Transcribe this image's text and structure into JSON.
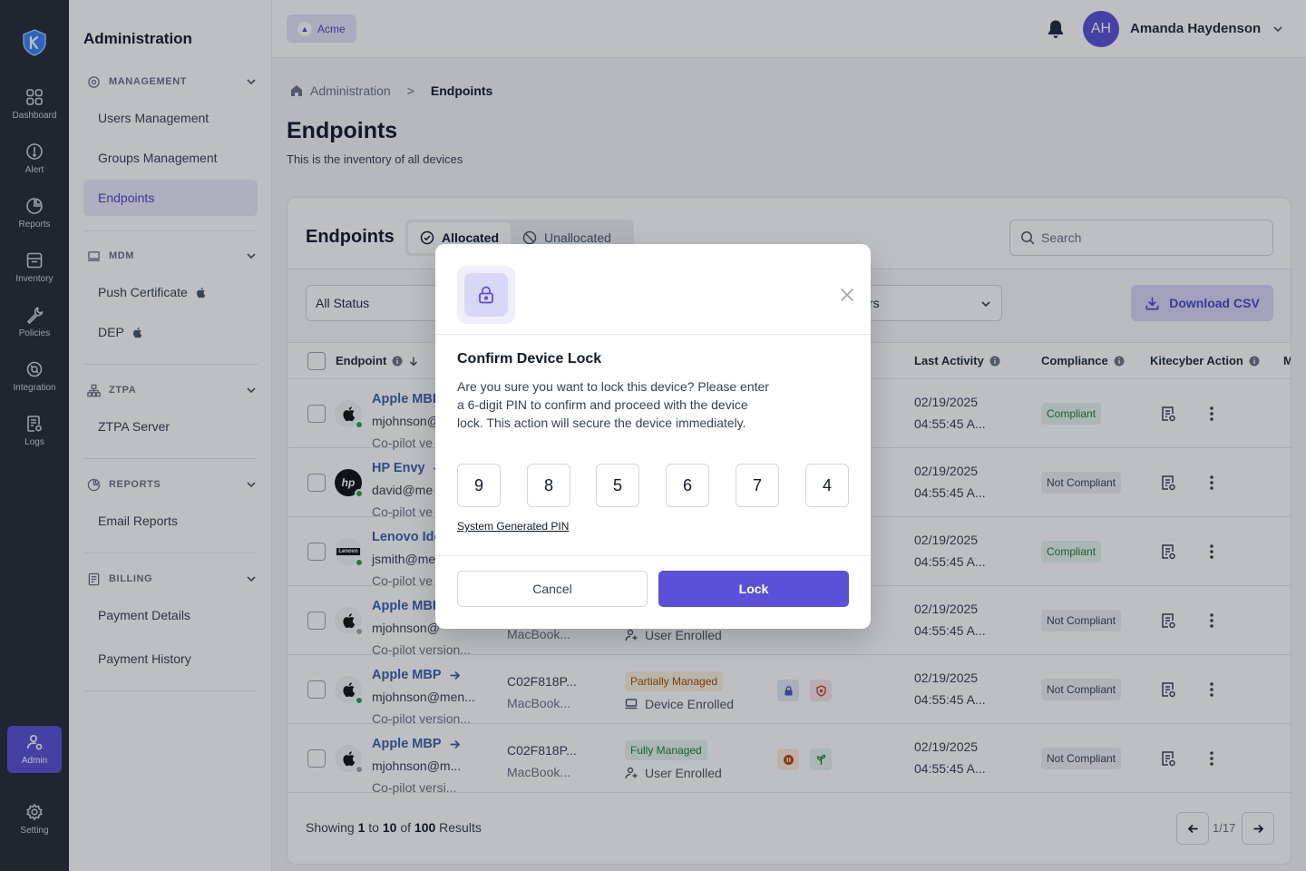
{
  "rail": {
    "items": [
      {
        "label": "Dashboard"
      },
      {
        "label": "Alert"
      },
      {
        "label": "Reports"
      },
      {
        "label": "Inventory"
      },
      {
        "label": "Policies"
      },
      {
        "label": "Integration"
      },
      {
        "label": "Logs"
      },
      {
        "label": "Admin"
      },
      {
        "label": "Setting"
      }
    ]
  },
  "sidebar": {
    "title": "Administration",
    "sections": [
      {
        "label": "MANAGEMENT",
        "items": [
          "Users Management",
          "Groups Management",
          "Endpoints"
        ]
      },
      {
        "label": "MDM",
        "items": [
          "Push Certificate",
          "DEP"
        ]
      },
      {
        "label": "ZTPA",
        "items": [
          "ZTPA Server"
        ]
      },
      {
        "label": "REPORTS",
        "items": [
          "Email Reports"
        ]
      },
      {
        "label": "BILLING",
        "items": [
          "Payment Details",
          "Payment History"
        ]
      }
    ]
  },
  "header": {
    "tenant": "Acme",
    "avatar_initials": "AH",
    "user_name": "Amanda Haydenson"
  },
  "breadcrumb": {
    "parent": "Administration",
    "current": "Endpoints"
  },
  "page": {
    "title": "Endpoints",
    "subtitle": "This is the inventory of all devices"
  },
  "card": {
    "title": "Endpoints",
    "tabs": [
      "Allocated",
      "Unallocated"
    ],
    "search_placeholder": "Search",
    "filters": {
      "status": "All Status",
      "other_tail": "rs"
    },
    "download_label": "Download CSV"
  },
  "table": {
    "columns": {
      "endpoint": "Endpoint",
      "last_activity": "Last Activity",
      "compliance": "Compliance",
      "action": "Kitecyber Action",
      "more": "M"
    },
    "rows": [
      {
        "name": "Apple MBP",
        "user": "mjohnson@",
        "agent": "Co-pilot ve",
        "serial": "",
        "model": "",
        "mgmt": "",
        "enroll": "",
        "date": "02/19/2025",
        "time": "04:55:45 A...",
        "compliance": "Compliant"
      },
      {
        "name": "HP Envy",
        "user": "david@me",
        "agent": "Co-pilot ve",
        "serial": "",
        "model": "",
        "mgmt": "",
        "enroll": "",
        "date": "02/19/2025",
        "time": "04:55:45 A...",
        "compliance": "Not Compliant"
      },
      {
        "name": "Lenovo Ide",
        "user": "jsmith@me",
        "agent": "Co-pilot ve",
        "serial": "",
        "model": "",
        "mgmt": "",
        "enroll": "",
        "date": "02/19/2025",
        "time": "04:55:45 A...",
        "compliance": "Compliant"
      },
      {
        "name": "Apple MBP",
        "user": "mjohnson@",
        "agent": "Co-pilot version...",
        "serial": "",
        "model": "MacBook...",
        "mgmt": "",
        "enroll": "User Enrolled",
        "date": "02/19/2025",
        "time": "04:55:45 A...",
        "compliance": "Not Compliant"
      },
      {
        "name": "Apple MBP",
        "user": "mjohnson@men...",
        "agent": "Co-pilot version...",
        "serial": "C02F818P...",
        "model": "MacBook...",
        "mgmt": "Partially Managed",
        "enroll": "Device Enrolled",
        "date": "02/19/2025",
        "time": "04:55:45 A...",
        "compliance": "Not Compliant"
      },
      {
        "name": "Apple MBP",
        "user": "mjohnson@m...",
        "agent": "Co-pilot versi...",
        "serial": "C02F818P...",
        "model": "MacBook...",
        "mgmt": "Fully Managed",
        "enroll": "User Enrolled",
        "date": "02/19/2025",
        "time": "04:55:45 A...",
        "compliance": "Not Compliant"
      }
    ]
  },
  "footer": {
    "showing": "Showing",
    "from": "1",
    "to_word": "to",
    "to": "10",
    "of_word": "of",
    "total": "100",
    "results": "Results",
    "page": "1/17"
  },
  "modal": {
    "title": "Confirm Device Lock",
    "message": "Are you sure you want to lock this device? Please enter a 6-digit PIN to confirm and proceed with the device lock. This action will secure the device immediately.",
    "pin": [
      "9",
      "8",
      "5",
      "6",
      "7",
      "4"
    ],
    "pin_link": "System Generated PIN",
    "cancel": "Cancel",
    "confirm": "Lock"
  },
  "colors": {
    "accent": "#5b50d6",
    "rail": "#262a33",
    "link": "#3f5fa8"
  }
}
